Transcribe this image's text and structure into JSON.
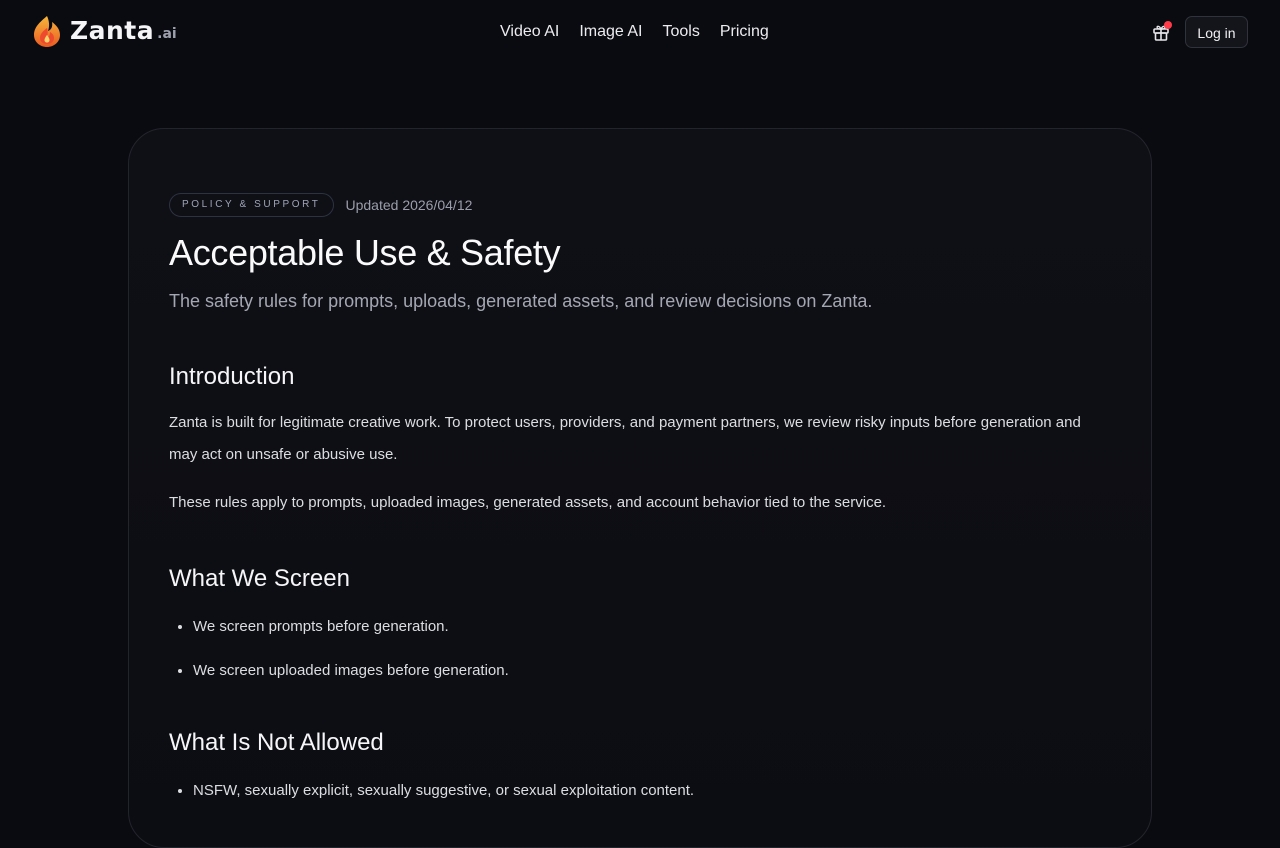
{
  "brand": {
    "name": "Zanta",
    "tld": ".ai",
    "colors": {
      "flame_outer": "#f0a12a",
      "flame_inner": "#ee4b2e"
    }
  },
  "nav": {
    "items": [
      {
        "label": "Video AI"
      },
      {
        "label": "Image AI"
      },
      {
        "label": "Tools"
      },
      {
        "label": "Pricing"
      }
    ]
  },
  "header_actions": {
    "gift_icon": "gift-icon",
    "notification_dot_color": "#ff3b4a",
    "login_label": "Log in"
  },
  "article": {
    "tag": "POLICY & SUPPORT",
    "updated": "Updated 2026/04/12",
    "title": "Acceptable Use & Safety",
    "subtitle": "The safety rules for prompts, uploads, generated assets, and review decisions on Zanta.",
    "sections": [
      {
        "heading": "Introduction",
        "paragraphs": [
          "Zanta is built for legitimate creative work. To protect users, providers, and payment partners, we review risky inputs before generation and may act on unsafe or abusive use.",
          "These rules apply to prompts, uploaded images, generated assets, and account behavior tied to the service."
        ]
      },
      {
        "heading": "What We Screen",
        "bullets": [
          "We screen prompts before generation.",
          "We screen uploaded images before generation."
        ]
      },
      {
        "heading": "What Is Not Allowed",
        "bullets": [
          "NSFW, sexually explicit, sexually suggestive, or sexual exploitation content."
        ]
      }
    ]
  }
}
